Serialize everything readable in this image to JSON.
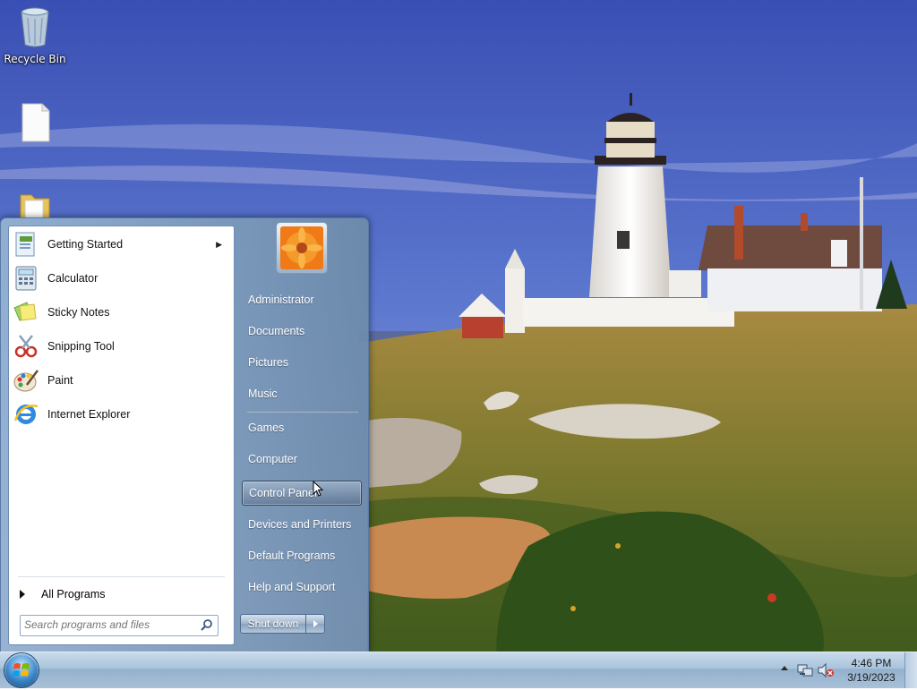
{
  "desktop": {
    "icons": [
      {
        "label": "Recycle Bin",
        "icon": "recycle-bin-icon"
      },
      {
        "label": "",
        "icon": "document-icon"
      },
      {
        "label": "",
        "icon": "folder-icon"
      }
    ]
  },
  "start_menu": {
    "programs": [
      {
        "label": "Getting Started",
        "icon": "getting-started-icon",
        "has_submenu": true
      },
      {
        "label": "Calculator",
        "icon": "calculator-icon"
      },
      {
        "label": "Sticky Notes",
        "icon": "sticky-notes-icon"
      },
      {
        "label": "Snipping Tool",
        "icon": "snipping-tool-icon"
      },
      {
        "label": "Paint",
        "icon": "paint-icon"
      },
      {
        "label": "Internet Explorer",
        "icon": "internet-explorer-icon"
      }
    ],
    "all_programs": "All Programs",
    "search_placeholder": "Search programs and files",
    "places": [
      {
        "label": "Administrator"
      },
      {
        "label": "Documents"
      },
      {
        "label": "Pictures"
      },
      {
        "label": "Music"
      },
      {
        "label": "Games"
      },
      {
        "label": "Computer"
      },
      {
        "label": "Control Panel",
        "highlighted": true
      },
      {
        "label": "Devices and Printers"
      },
      {
        "label": "Default Programs"
      },
      {
        "label": "Help and Support"
      }
    ],
    "shutdown_label": "Shut down"
  },
  "taskbar": {
    "time": "4:46 PM",
    "date": "3/19/2023",
    "tray_icons": [
      "show-hidden-icons-chevron",
      "network-icon",
      "volume-muted-icon"
    ]
  }
}
